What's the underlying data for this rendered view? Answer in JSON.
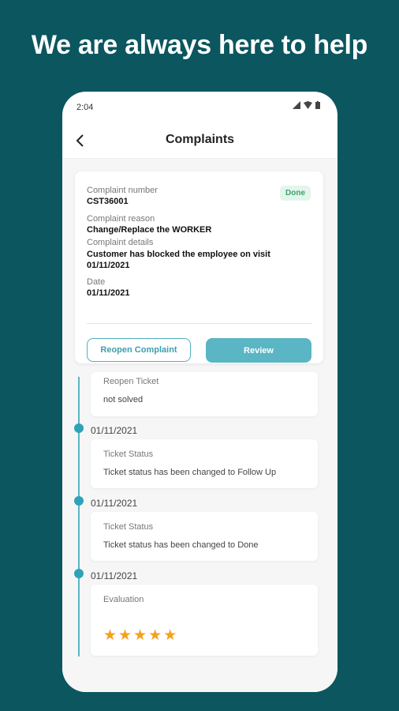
{
  "headline": "We are always here to help",
  "status": {
    "time": "2:04"
  },
  "appbar": {
    "title": "Complaints"
  },
  "complaint": {
    "number_label": "Complaint number",
    "number": "CST36001",
    "badge": "Done",
    "reason_label": "Complaint reason",
    "reason": "Change/Replace the WORKER",
    "details_label": "Complaint details",
    "details_line1": "Customer has blocked the employee on visit",
    "details_line2": "01/11/2021",
    "date_label": "Date",
    "date": "01/11/2021",
    "reopen_label": "Reopen Complaint",
    "review_label": "Review"
  },
  "timeline": [
    {
      "date": "",
      "title": "Reopen Ticket",
      "text": "not solved"
    },
    {
      "date": "01/11/2021",
      "title": "Ticket Status",
      "text": "Ticket status has been changed to Follow Up"
    },
    {
      "date": "01/11/2021",
      "title": "Ticket Status",
      "text": "Ticket status has been changed to Done"
    },
    {
      "date": "01/11/2021",
      "title": "Evaluation",
      "rating": 5
    }
  ],
  "colors": {
    "background": "#0b565f",
    "accent": "#5ab5c4",
    "star": "#f4a11d",
    "done_badge": "#3da46a"
  }
}
